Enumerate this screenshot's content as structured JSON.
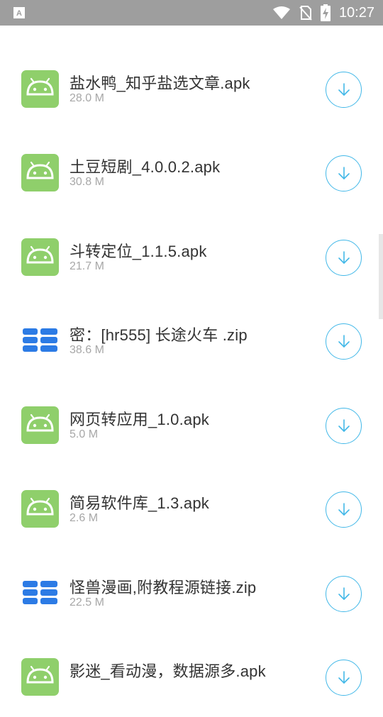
{
  "status_bar": {
    "time": "10:27",
    "icons": [
      "notification-a-icon",
      "wifi-icon",
      "no-sim-icon",
      "battery-charging-icon"
    ]
  },
  "colors": {
    "android_green": "#8fcf6b",
    "zip_blue": "#2c7be5",
    "download_ring": "#42b8e8",
    "status_bar_bg": "#9e9e9e"
  },
  "files": [
    {
      "name": "盐水鸭_知乎盐选文章.apk",
      "size": "28.0 M",
      "icon": "android-apk-icon"
    },
    {
      "name": "土豆短剧_4.0.0.2.apk",
      "size": "30.8 M",
      "icon": "android-apk-icon"
    },
    {
      "name": "斗转定位_1.1.5.apk",
      "size": "21.7 M",
      "icon": "android-apk-icon"
    },
    {
      "name": "密：[hr555] 长途火车 .zip",
      "size": "38.6 M",
      "icon": "zip-archive-icon"
    },
    {
      "name": "网页转应用_1.0.apk",
      "size": "5.0 M",
      "icon": "android-apk-icon"
    },
    {
      "name": "简易软件库_1.3.apk",
      "size": "2.6 M",
      "icon": "android-apk-icon"
    },
    {
      "name": "怪兽漫画,附教程源链接.zip",
      "size": "22.5 M",
      "icon": "zip-archive-icon"
    },
    {
      "name": "影迷_看动漫，数据源多.apk",
      "size": "",
      "icon": "android-apk-icon"
    }
  ]
}
